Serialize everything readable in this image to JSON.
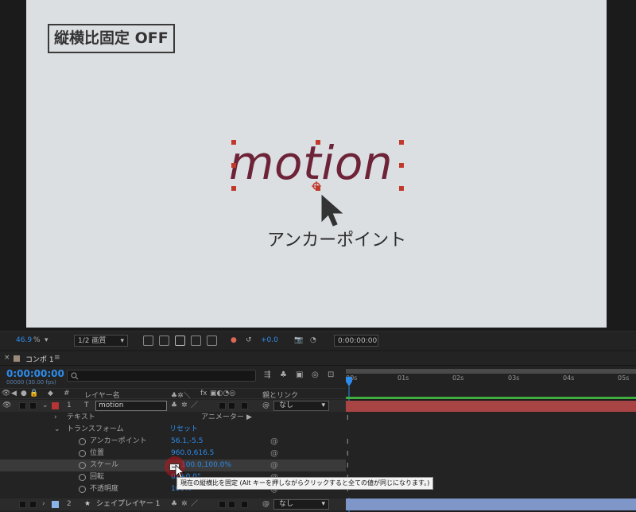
{
  "overlay": {
    "label": "縦横比固定 OFF",
    "caption": "アンカーポイント"
  },
  "canvas_text": "motion",
  "viewer_toolbar": {
    "zoom": "46.9",
    "zoom_unit": "%",
    "resolution": "1/2 画質",
    "exposure": "+0.0",
    "timecode": "0:00:00:00"
  },
  "panel": {
    "close": "×",
    "title": "コンポ 1",
    "menu": "≡"
  },
  "time": {
    "current": "0:00:00:00",
    "sub": "00000 (30.00 fps)"
  },
  "ruler_ticks": [
    "00s",
    "01s",
    "02s",
    "03s",
    "04s",
    "05s"
  ],
  "columns": {
    "num": "#",
    "layer_name": "レイヤー名",
    "fx": "fx",
    "parent": "親とリンク"
  },
  "layers": [
    {
      "num": "1",
      "name": "motion",
      "parent": "なし",
      "color": "#b33535"
    },
    {
      "num": "2",
      "name": "シェイプレイヤー 1",
      "parent": "なし",
      "color": "#8ab4e8"
    }
  ],
  "properties": {
    "text": "テキスト",
    "animator": "アニメーター",
    "transform": "トランスフォーム",
    "reset": "リセット",
    "anchor": {
      "label": "アンカーポイント",
      "value": "56.1,-5.5"
    },
    "position": {
      "label": "位置",
      "value": "960.0,616.5"
    },
    "scale": {
      "label": "スケール",
      "value": "100.0,100.0%"
    },
    "rotation": {
      "label": "回転",
      "value": "0x+0.0°"
    },
    "opacity": {
      "label": "不透明度",
      "value": "100%"
    }
  },
  "tooltip": "現在の縦横比を固定 (Alt キーを押しながらクリックすると全ての値が同じになります。)",
  "colors": {
    "accent": "#2d8ceb",
    "text_color": "#6d2338",
    "layer1": "#b33535",
    "layer2": "#8ab4e8"
  }
}
